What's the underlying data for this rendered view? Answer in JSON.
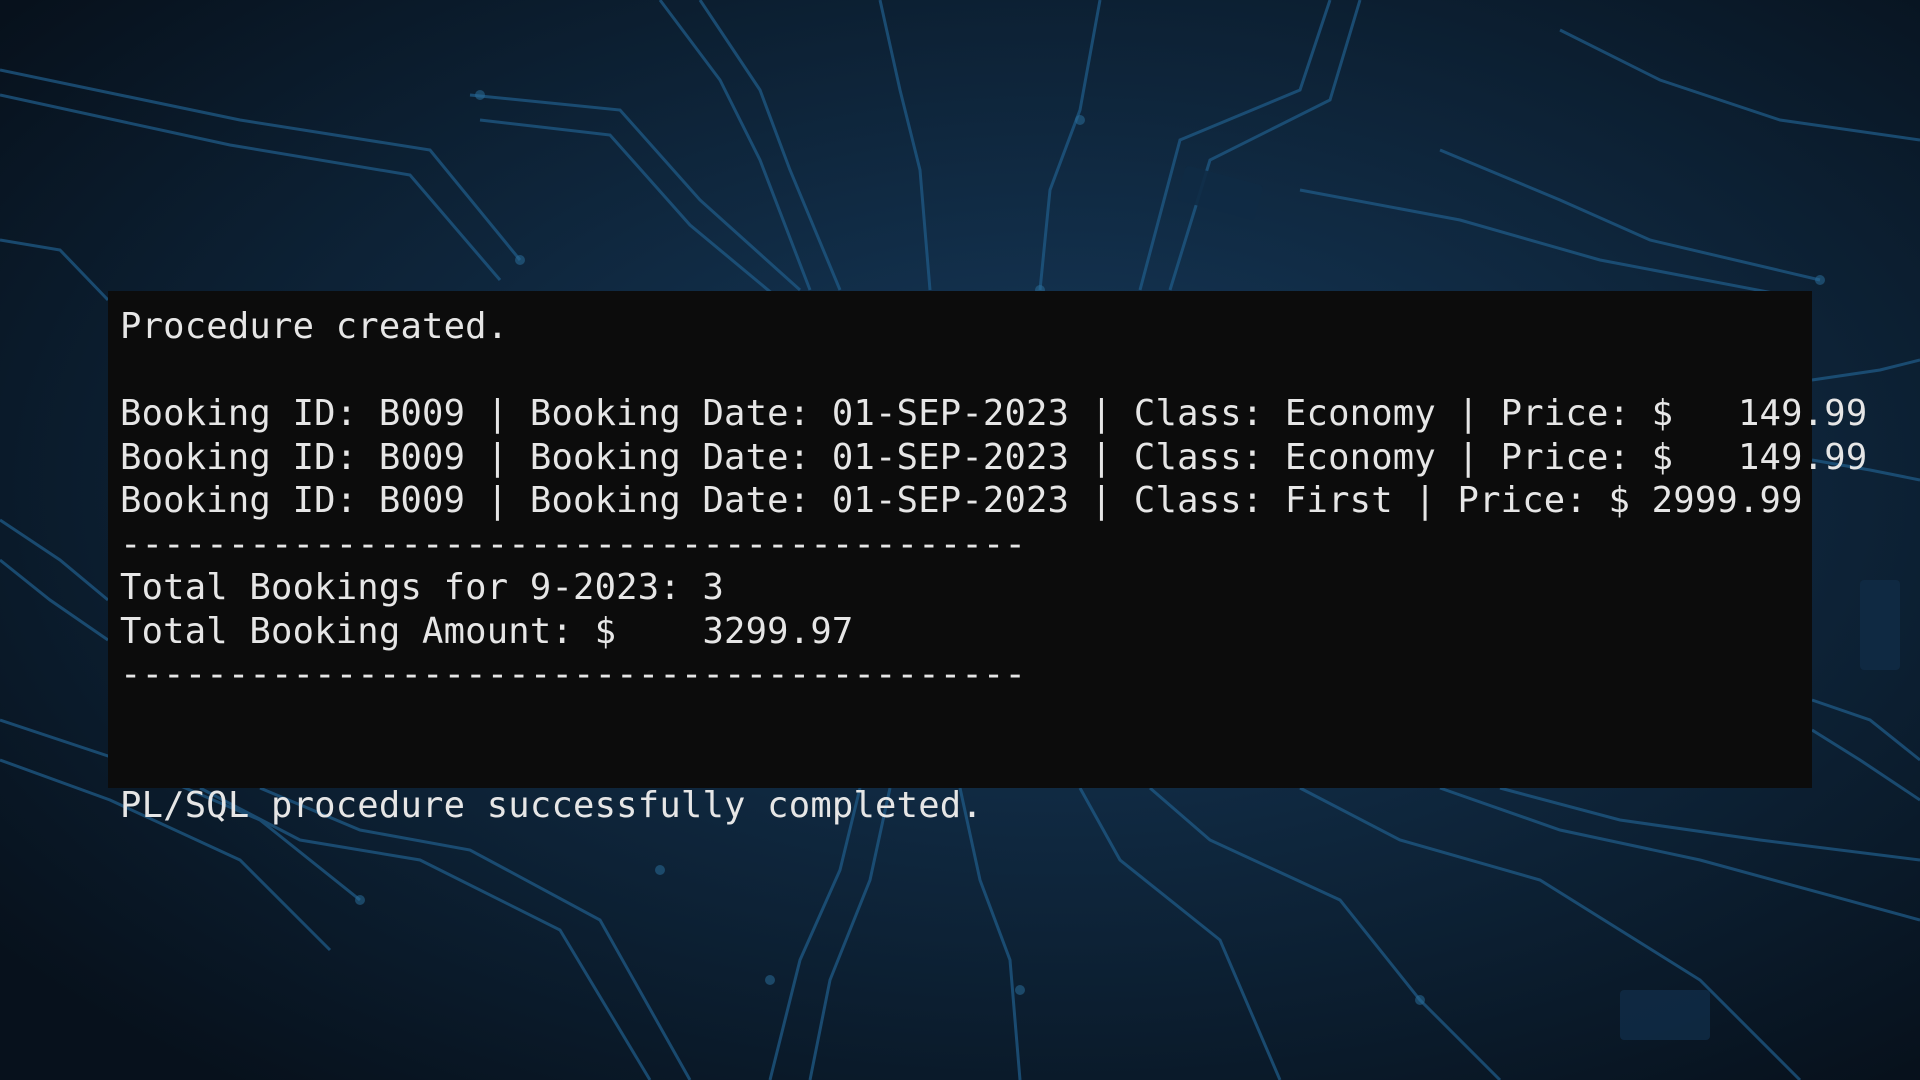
{
  "terminal": {
    "lines": [
      "Procedure created.",
      "",
      "Booking ID: B009 | Booking Date: 01-SEP-2023 | Class: Economy | Price: $   149.99",
      "Booking ID: B009 | Booking Date: 01-SEP-2023 | Class: Economy | Price: $   149.99",
      "Booking ID: B009 | Booking Date: 01-SEP-2023 | Class: First | Price: $ 2999.99",
      "------------------------------------------",
      "Total Bookings for 9-2023: 3",
      "Total Booking Amount: $    3299.97",
      "------------------------------------------",
      "",
      "",
      "PL/SQL procedure successfully completed."
    ]
  },
  "colors": {
    "background": "#0b1725",
    "circuit": "#1f5a86",
    "terminal_bg": "#0c0c0c",
    "terminal_text": "#e6e6e6"
  }
}
